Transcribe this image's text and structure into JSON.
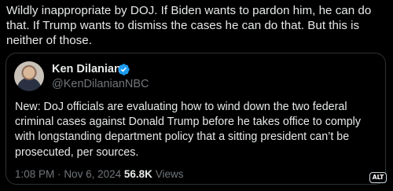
{
  "post": {
    "text": "Wildly inappropriate by DOJ. If Biden wants to pardon him, he can do that. If Trump wants to dismiss the cases he can do that. But this is neither of those."
  },
  "quoted": {
    "author_name": "Ken Dilanian",
    "handle": "@KenDilanianNBC",
    "verified_icon": "verified-badge-icon",
    "body": "New: DoJ officials are evaluating how to wind down the two federal criminal cases against Donald Trump before he takes office to comply with longstanding department policy that a sitting president can’t be prosecuted, per sources.",
    "time": "1:08 PM",
    "separator": "·",
    "date": "Nov 6, 2024",
    "views_count": "56.8K",
    "views_label": "Views"
  },
  "alt_badge": "ALT",
  "colors": {
    "background": "#000000",
    "text": "#e7e9ea",
    "muted": "#71767b",
    "verified": "#1d9bf0",
    "border": "#2f3336"
  }
}
